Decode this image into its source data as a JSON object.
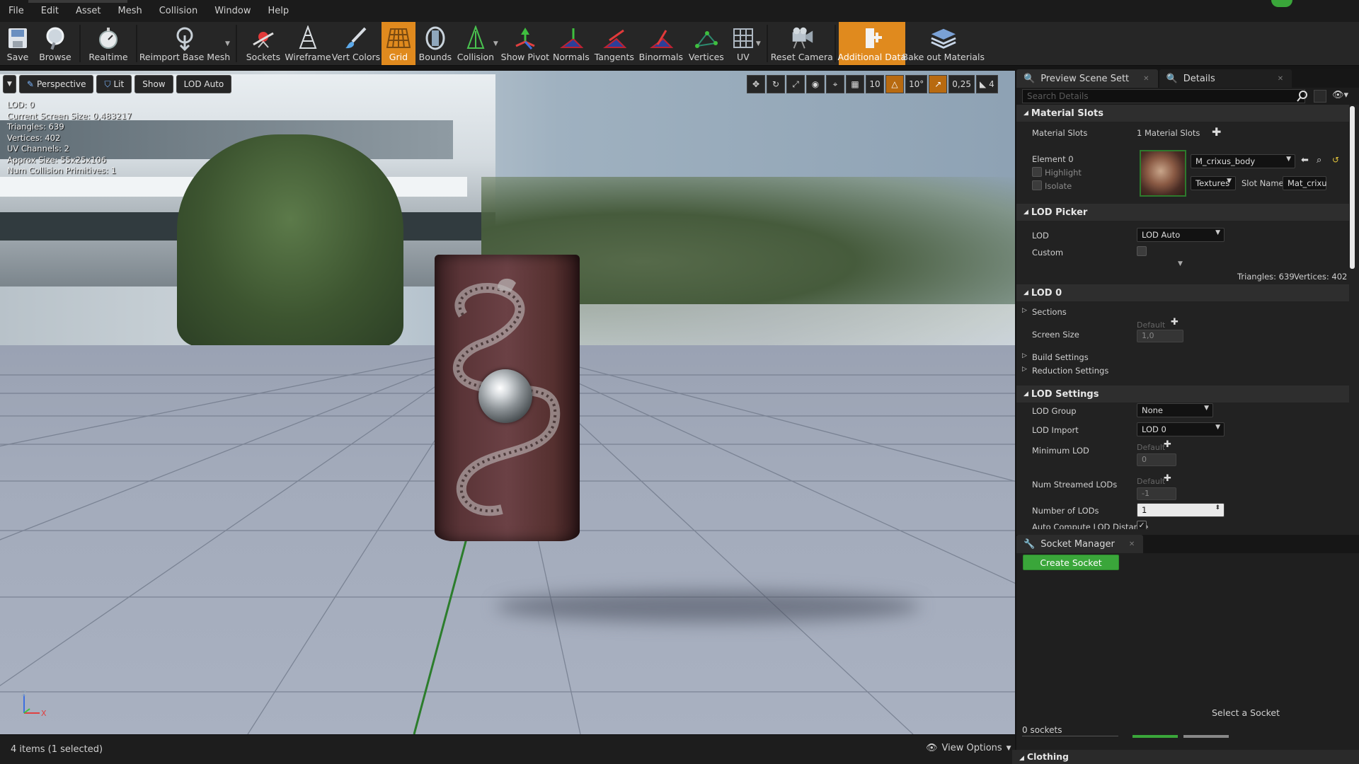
{
  "menu": [
    "File",
    "Edit",
    "Asset",
    "Mesh",
    "Collision",
    "Window",
    "Help"
  ],
  "toolbar": {
    "save": "Save",
    "browse": "Browse",
    "realtime": "Realtime",
    "reimport": "Reimport Base Mesh",
    "sockets": "Sockets",
    "wireframe": "Wireframe",
    "vert_colors": "Vert Colors",
    "grid": "Grid",
    "bounds": "Bounds",
    "collision": "Collision",
    "show_pivot": "Show Pivot",
    "normals": "Normals",
    "tangents": "Tangents",
    "binormals": "Binormals",
    "vertices": "Vertices",
    "uv": "UV",
    "reset_camera": "Reset Camera",
    "additional_data": "Additional Data",
    "bake_out": "Bake out Materials"
  },
  "viewport": {
    "perspective": "Perspective",
    "lit": "Lit",
    "show": "Show",
    "lod": "LOD Auto",
    "grid_size": "10",
    "rot_snap": "10°",
    "scale_snap": "0,25",
    "cam_speed": "4",
    "stats": [
      "LOD:  0",
      "Current Screen Size:  0,483217",
      "Triangles:  639",
      "Vertices:  402",
      "UV Channels:  2",
      "Approx Size: 55x25x106",
      "Num Collision Primitives:  1"
    ],
    "axis_z": "Z",
    "axis_x": "X"
  },
  "status": {
    "selection": "4 items (1 selected)",
    "view_options": "View Options"
  },
  "panel": {
    "tab_preview": "Preview Scene Sett",
    "tab_details": "Details",
    "search_placeholder": "Search Details",
    "material_slots_cat": "Material Slots",
    "material_slots_label": "Material Slots",
    "material_slots_value": "1 Material Slots",
    "element0": "Element 0",
    "highlight": "Highlight",
    "isolate": "Isolate",
    "material_name": "M_crixus_body",
    "textures": "Textures",
    "slot_name_label": "Slot Name",
    "slot_name_value": "Mat_crixu",
    "lod_picker_cat": "LOD Picker",
    "lod_label": "LOD",
    "lod_value": "LOD Auto",
    "custom": "Custom",
    "triangles_summary": "Triangles: 639",
    "vertices_summary": "Vertices: 402",
    "lod0_cat": "LOD 0",
    "sections": "Sections",
    "screen_size": "Screen Size",
    "default": "Default",
    "screen_size_value": "1,0",
    "build_settings": "Build Settings",
    "reduction_settings": "Reduction Settings",
    "lod_settings_cat": "LOD Settings",
    "lod_group": "LOD Group",
    "lod_group_value": "None",
    "lod_import": "LOD Import",
    "lod_import_value": "LOD 0",
    "minimum_lod": "Minimum LOD",
    "minimum_lod_value": "0",
    "num_streamed": "Num Streamed LODs",
    "num_streamed_value": "-1",
    "number_of_lods": "Number of LODs",
    "number_of_lods_value": "1",
    "auto_compute": "Auto Compute LOD Distance"
  },
  "socket": {
    "tab": "Socket Manager",
    "create": "Create Socket",
    "empty": "Select a Socket",
    "count": "0 sockets"
  },
  "clothing": "Clothing"
}
